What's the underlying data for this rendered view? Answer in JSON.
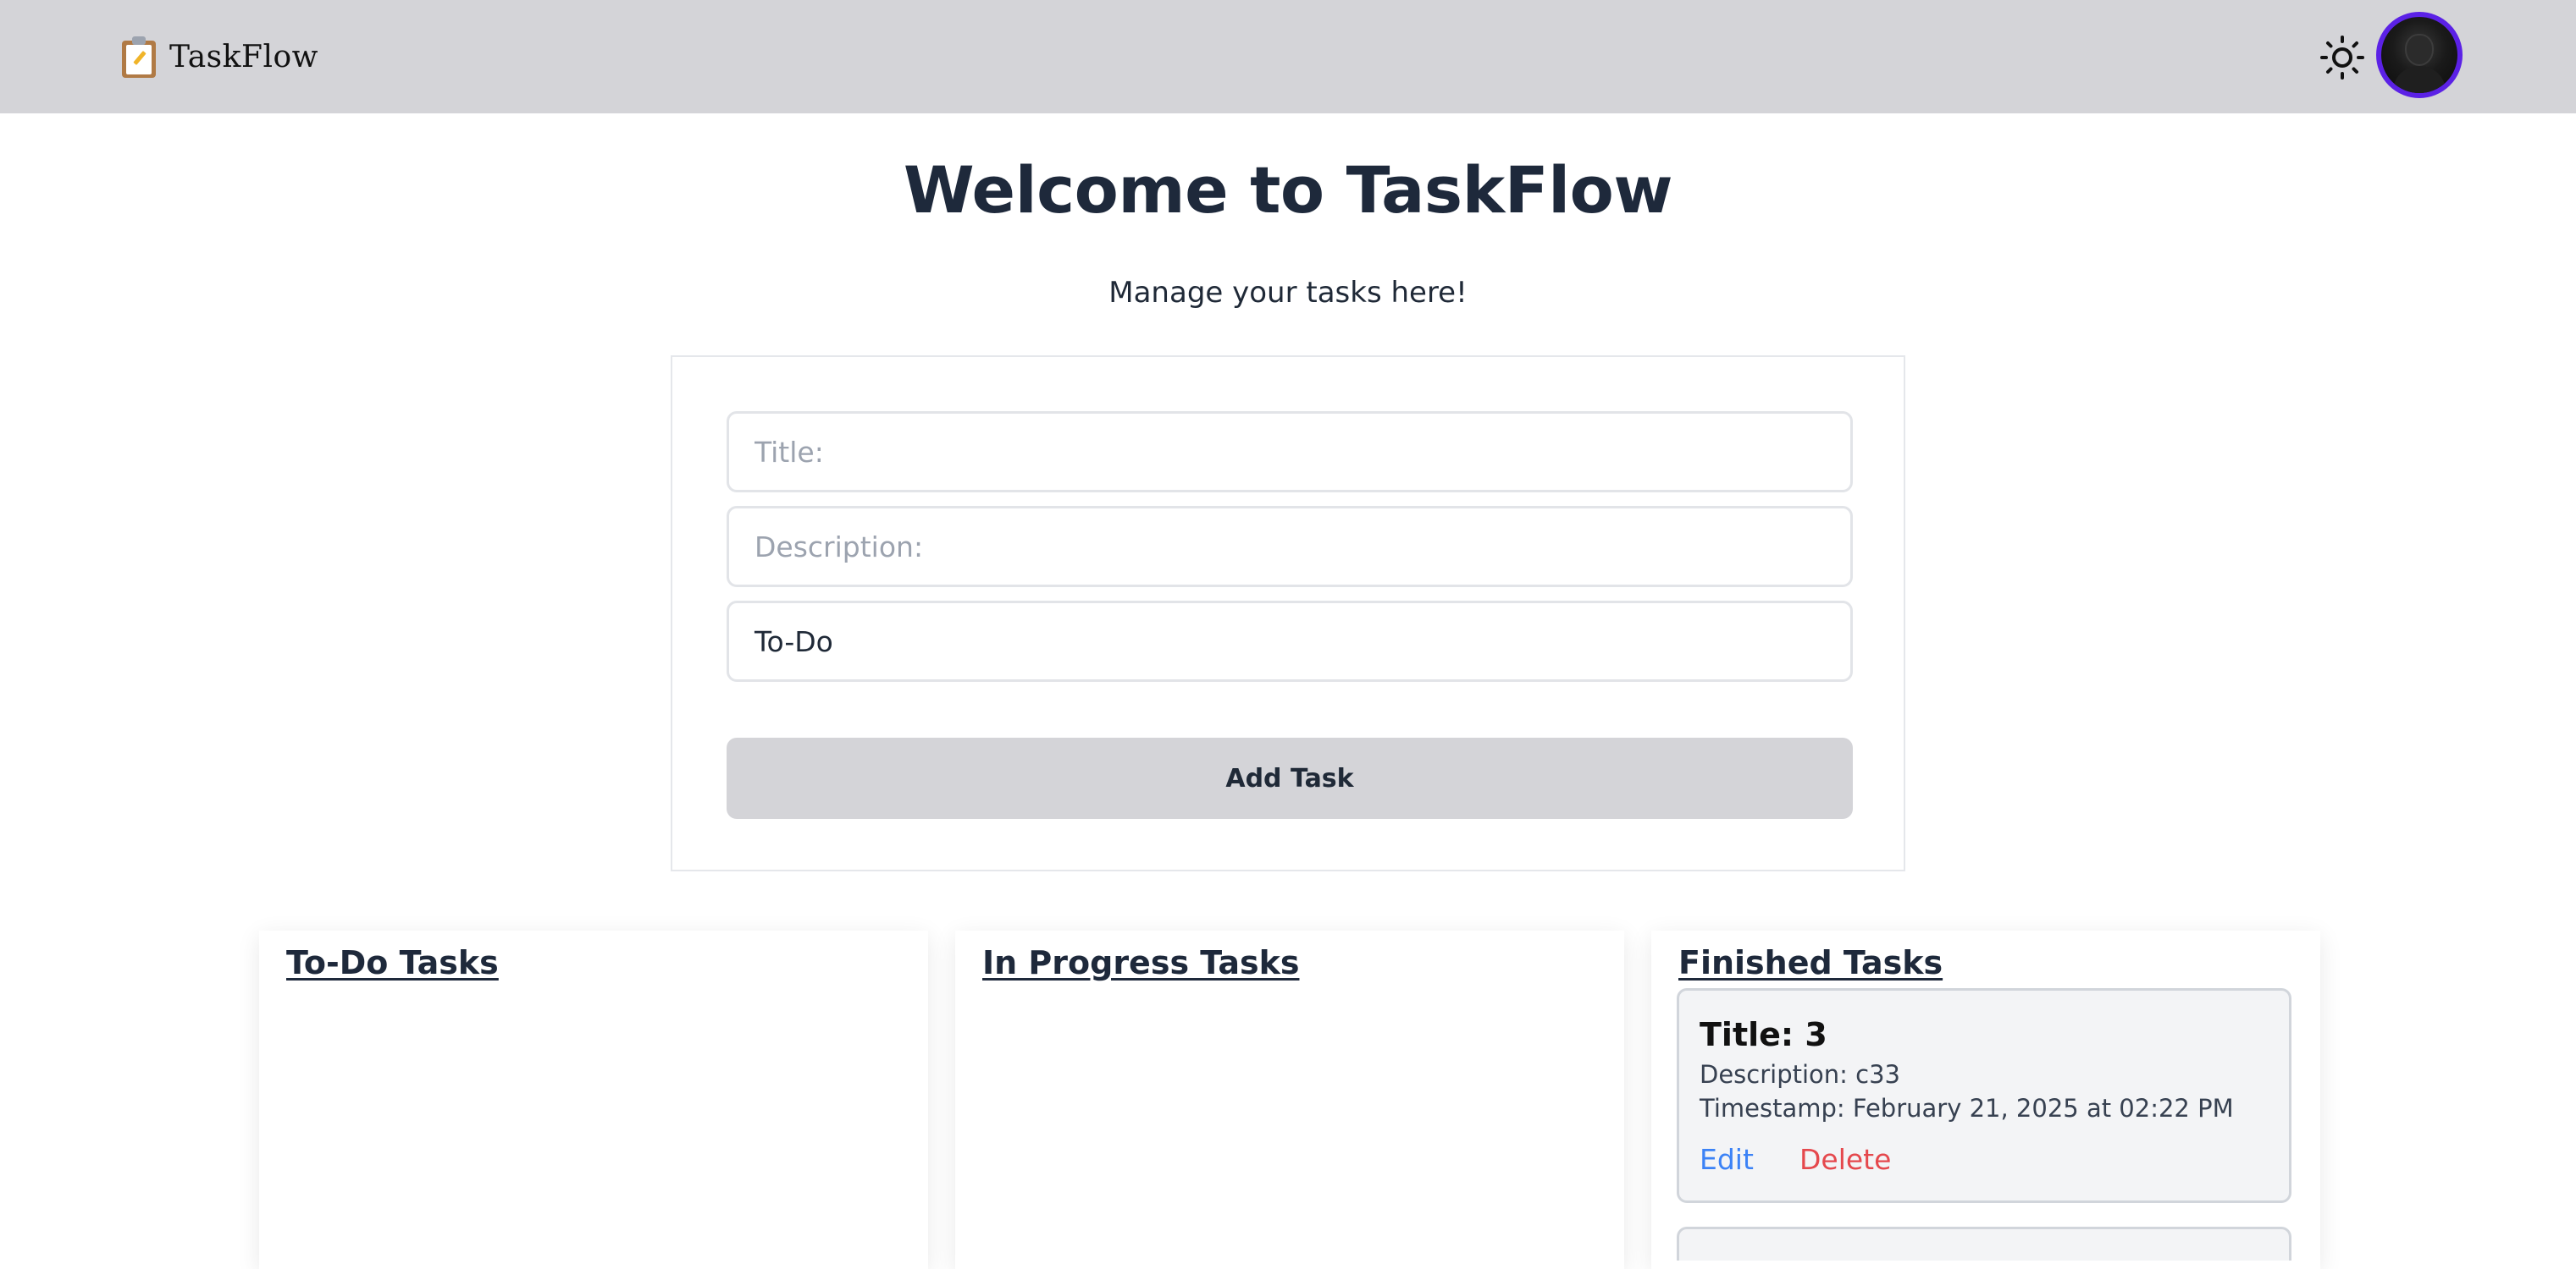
{
  "navbar": {
    "brand_text": "TaskFlow",
    "brand_icon": "clipboard-icon",
    "theme_icon": "sun-icon",
    "avatar_icon": "user-avatar"
  },
  "hero": {
    "title": "Welcome to TaskFlow",
    "subtitle": "Manage your tasks here!"
  },
  "form": {
    "title_placeholder": "Title:",
    "title_value": "",
    "description_placeholder": "Description:",
    "description_value": "",
    "status_value": "To-Do",
    "submit_label": "Add Task"
  },
  "columns": [
    {
      "title": "To-Do Tasks",
      "tasks": []
    },
    {
      "title": "In Progress Tasks",
      "tasks": []
    },
    {
      "title": "Finished Tasks",
      "tasks": [
        {
          "title": "Title: 3",
          "description": "Description: c33",
          "timestamp": "Timestamp: February 21, 2025 at 02:22 PM",
          "edit_label": "Edit",
          "delete_label": "Delete"
        }
      ]
    }
  ],
  "colors": {
    "navbar_bg": "#d4d4d8",
    "avatar_ring": "#5b21e6",
    "edit_link": "#3b82f6",
    "delete_link": "#e5484d",
    "heading": "#1e293b"
  }
}
